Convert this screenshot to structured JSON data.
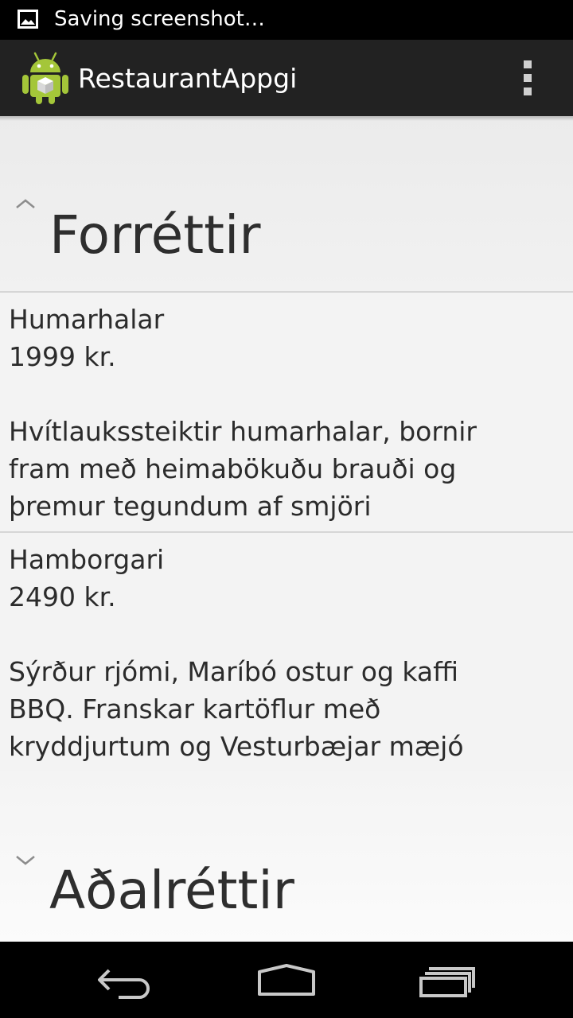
{
  "status_bar": {
    "notification_icon": "image-icon",
    "text": "Saving screenshot…"
  },
  "action_bar": {
    "app_icon": "android-icon",
    "title": "RestaurantAppgi",
    "overflow_icon": "overflow-menu-icon"
  },
  "groups": [
    {
      "title": "Forréttir",
      "state": "expanded",
      "indicator_icon": "chevron-up-icon",
      "items": [
        {
          "name": "Humarhalar",
          "price": "1999 kr.",
          "description_lines": [
            "Hvítlaukssteiktir humarhalar, bornir",
            "fram með heimabökuðu brauði og",
            "þremur tegundum af smjöri"
          ]
        },
        {
          "name": "Hamborgari",
          "price": "2490 kr.",
          "description_lines": [
            "Sýrður rjómi, Maríbó ostur og kaffi",
            "BBQ. Franskar kartöflur með",
            "kryddjurtum og Vesturbæjar mæjó"
          ]
        }
      ]
    },
    {
      "title": "Aðalréttir",
      "state": "collapsed",
      "indicator_icon": "chevron-down-icon",
      "items": []
    }
  ],
  "nav_bar": {
    "back_icon": "back-icon",
    "home_icon": "home-icon",
    "recents_icon": "recent-apps-icon"
  },
  "colors": {
    "action_bar": "#222222",
    "content_background": "#f3f3f3",
    "divider": "#d6d6d6",
    "text": "#2b2b2b"
  }
}
